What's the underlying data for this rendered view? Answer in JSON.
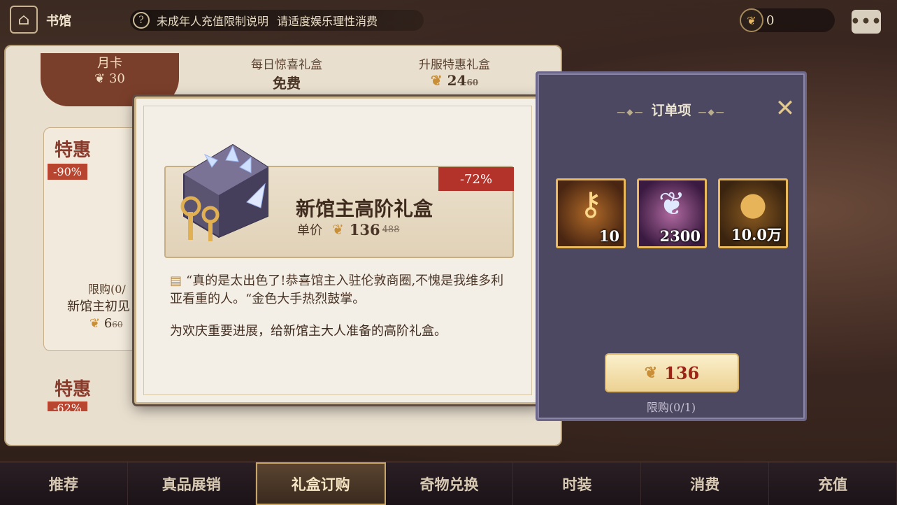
{
  "topbar": {
    "hall_label": "书馆",
    "notice_help": "?",
    "notice_text": "未成年人充值限制说明",
    "notice_tip": "请适度娱乐理性消费",
    "currency_value": "0",
    "chat_icon": "•••"
  },
  "background_shop": {
    "monthly": {
      "label": "月卡",
      "price": "30"
    },
    "daily": {
      "label": "每日惊喜礼盒",
      "price": "免费"
    },
    "upgrade": {
      "label": "升服特惠礼盒",
      "price": "24",
      "old_price": "60"
    },
    "card1": {
      "special": "特惠",
      "discount": "-90%",
      "limit": "限购(0/",
      "name": "新馆主初见",
      "price": "6",
      "old_price": "60"
    },
    "card2": {
      "special": "特惠",
      "discount": "-62%"
    }
  },
  "product": {
    "name": "新馆主高阶礼盒",
    "unit_label": "单价",
    "price": "136",
    "old_price": "488",
    "discount": "-72%",
    "quote": "“真的是太出色了!恭喜馆主入驻伦敦商圈,不愧是我维多利亚看重的人。“金色大手热烈鼓掌。",
    "description": "为欢庆重要进展，给新馆主大人准备的高阶礼盒。"
  },
  "order": {
    "title": "订单项",
    "items": [
      {
        "icon": "key-icon",
        "count": "10"
      },
      {
        "icon": "feather-icon",
        "count": "2300"
      },
      {
        "icon": "coin-icon",
        "count": "10.0万"
      }
    ],
    "buy_price": "136",
    "limit": "限购(0/1)"
  },
  "tabs": [
    {
      "label": "推荐"
    },
    {
      "label": "真品展销"
    },
    {
      "label": "礼盒订购",
      "active": true
    },
    {
      "label": "奇物兑换"
    },
    {
      "label": "时装"
    },
    {
      "label": "消费"
    },
    {
      "label": "充值"
    }
  ]
}
